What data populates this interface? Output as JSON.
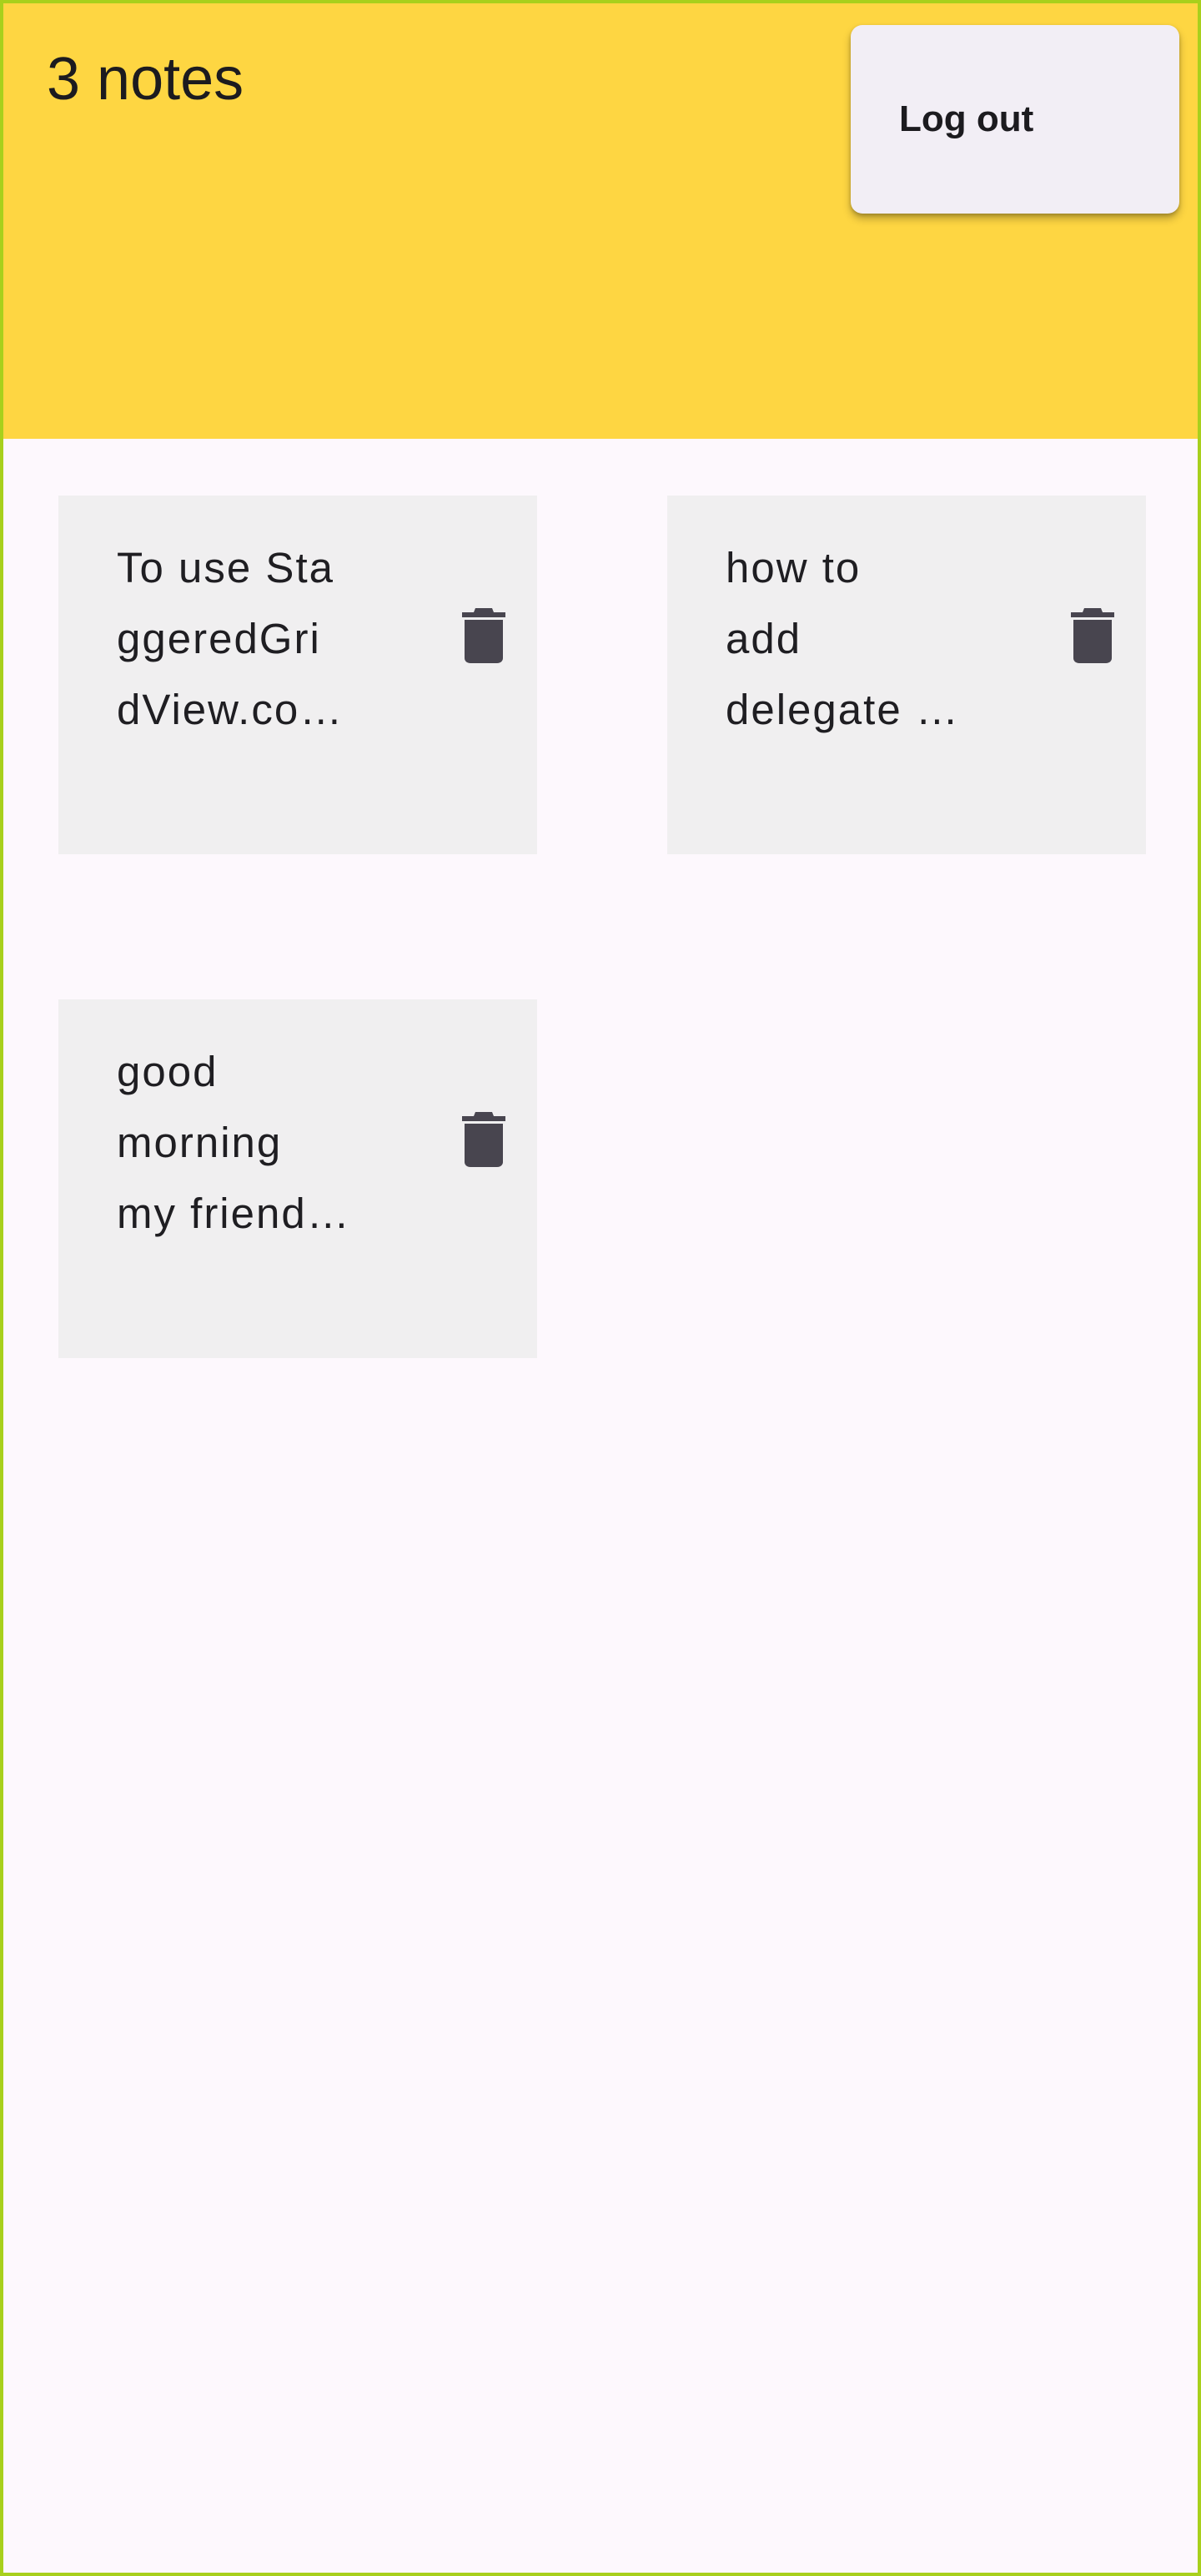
{
  "app_bar": {
    "title": "3 notes",
    "background_color": "#fed642"
  },
  "menu": {
    "items": [
      {
        "label": "Log out"
      }
    ]
  },
  "notes": [
    {
      "text": "To use Sta\nggeredGri\ndView.co…",
      "delete_icon": "trash-icon"
    },
    {
      "text": "how to\nadd\ndelegate …",
      "delete_icon": "trash-icon"
    },
    {
      "text": "good\nmorning\nmy friend…",
      "delete_icon": "trash-icon"
    }
  ],
  "colors": {
    "card_background": "#f0eff0",
    "page_background": "#fdf8fd",
    "icon_color": "#48454f",
    "frame_border": "#a8d01c"
  }
}
